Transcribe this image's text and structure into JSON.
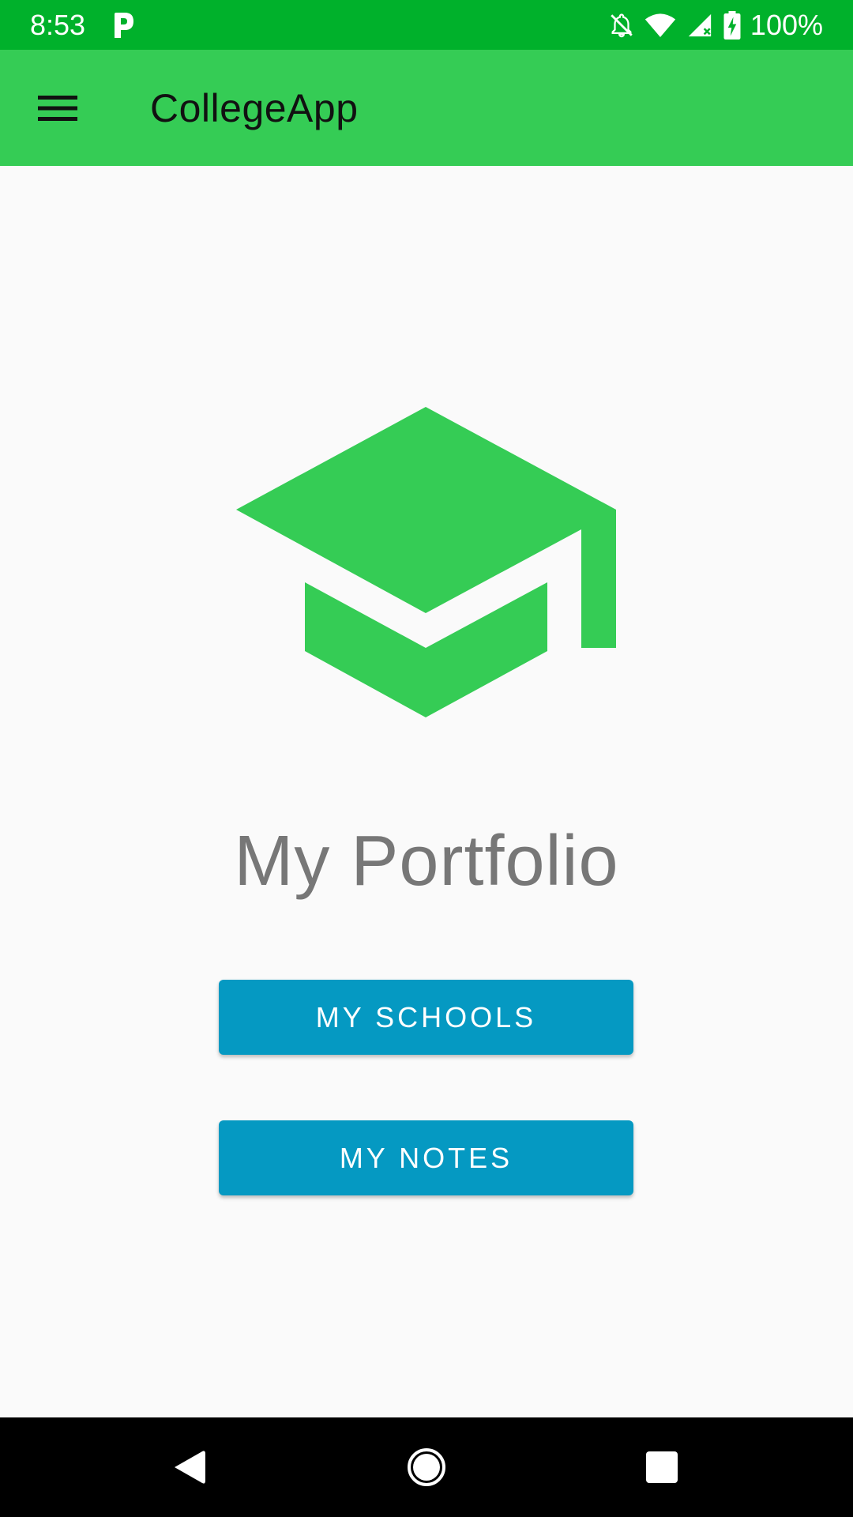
{
  "status_bar": {
    "time": "8:53",
    "battery_text": "100%",
    "icons": [
      "parking-p-icon",
      "notifications-off-icon",
      "wifi-icon",
      "cell-signal-icon",
      "battery-charging-icon"
    ]
  },
  "app_bar": {
    "title": "CollegeApp",
    "menu_icon": "hamburger-menu-icon",
    "background_color": "#35cc55"
  },
  "main": {
    "logo_icon": "graduation-cap-icon",
    "logo_color": "#35cc55",
    "title": "My Portfolio",
    "buttons": [
      {
        "label": "MY SCHOOLS"
      },
      {
        "label": "MY NOTES"
      }
    ],
    "button_color": "#0599c2"
  },
  "nav_bar": {
    "icons": [
      "back-icon",
      "home-icon",
      "recents-icon"
    ]
  },
  "colors": {
    "status_bar": "#00b12b",
    "background": "#fafafa",
    "title_text": "#777777"
  }
}
